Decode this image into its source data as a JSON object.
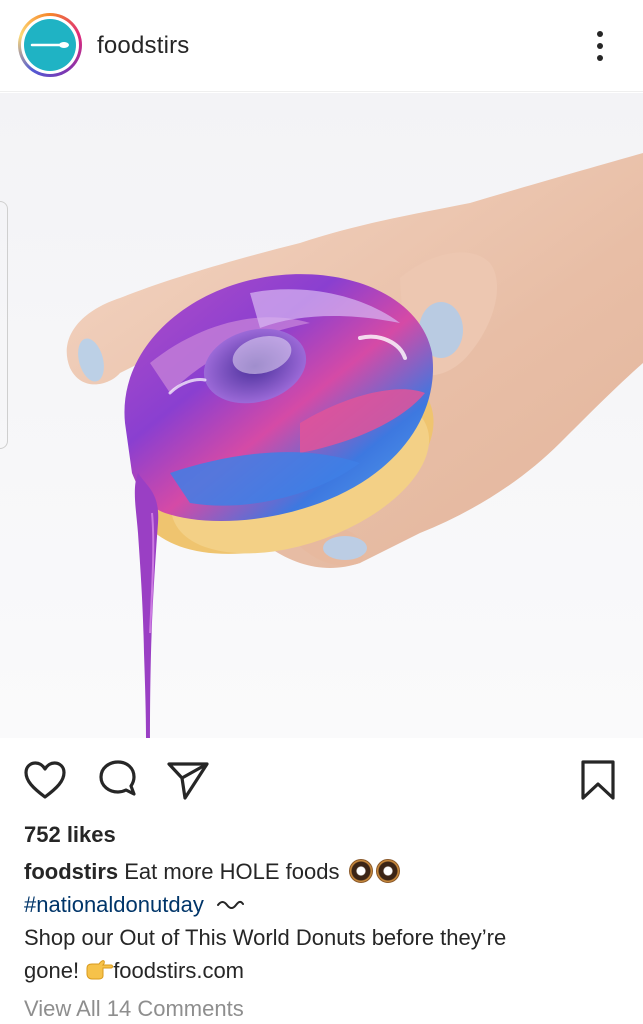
{
  "header": {
    "username": "foodstirs",
    "more_icon": "more-vertical-icon"
  },
  "post": {
    "image_alt": "Hand holding a donut with a swirled purple, pink and blue glaze dripping down"
  },
  "actions": {
    "like_icon": "heart-icon",
    "comment_icon": "comment-icon",
    "share_icon": "send-icon",
    "save_icon": "bookmark-icon"
  },
  "likes": "752 likes",
  "caption": {
    "username": "foodstirs",
    "text": "Eat more HOLE foods",
    "emoji": "donut-emoji",
    "hashtag": "#nationaldonutday",
    "line2": "Shop our Out of This World Donuts before they’re",
    "line3_start": "gone!",
    "link": "foodstirs.com"
  },
  "comments_link": "View All 14 Comments",
  "colors": {
    "avatar_bg": "#1fb3c4",
    "hashtag": "#003569",
    "muted_text": "#8e8e8e"
  }
}
